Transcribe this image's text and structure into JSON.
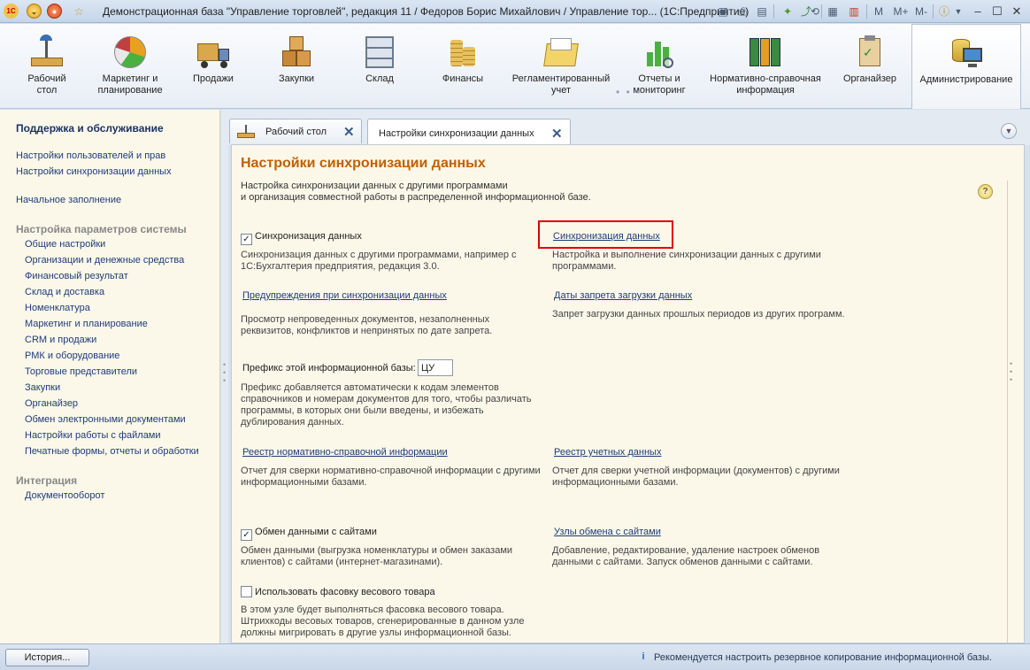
{
  "window": {
    "title": "Демонстрационная база \"Управление торговлей\", редакция 11 / Федоров Борис Михайлович / Управление тор...  (1С:Предприятие)",
    "app_badge": "1С",
    "memory_buttons": [
      "M",
      "M+",
      "M-"
    ]
  },
  "sections": [
    {
      "label": "Рабочий\nстол",
      "icon": "desk-icon"
    },
    {
      "label": "Маркетинг и\nпланирование",
      "icon": "pie-chart-icon"
    },
    {
      "label": "Продажи",
      "icon": "truck-icon"
    },
    {
      "label": "Закупки",
      "icon": "boxes-icon"
    },
    {
      "label": "Склад",
      "icon": "warehouse-icon"
    },
    {
      "label": "Финансы",
      "icon": "coins-icon"
    },
    {
      "label": "Регламентированный\nучет",
      "icon": "folder-icon"
    },
    {
      "label": "Отчеты и\nмониторинг",
      "icon": "bar-chart-icon"
    },
    {
      "label": "Нормативно-справочная\nинформация",
      "icon": "binders-icon"
    },
    {
      "label": "Органайзер",
      "icon": "clipboard-icon"
    },
    {
      "label": "Администрирование",
      "icon": "computer-icon"
    }
  ],
  "leftnav": {
    "group1_title": "Поддержка и обслуживание",
    "group1_items": [
      "Настройки пользователей и прав",
      "Настройки синхронизации данных"
    ],
    "initial_fill": "Начальное заполнение",
    "group2_title": "Настройка параметров системы",
    "group2_items": [
      "Общие настройки",
      "Организации и денежные средства",
      "Финансовый результат",
      "Склад и доставка",
      "Номенклатура",
      "Маркетинг и планирование",
      "CRM и продажи",
      "РМК и оборудование",
      "Торговые представители",
      "Закупки",
      "Органайзер",
      "Обмен электронными документами",
      "Настройки работы с файлами",
      "Печатные формы, отчеты и обработки"
    ],
    "group3_title": "Интеграция",
    "group3_items": [
      "Документооборот"
    ]
  },
  "tabs": [
    {
      "label": "Рабочий стол"
    },
    {
      "label": "Настройки синхронизации данных"
    }
  ],
  "content": {
    "title": "Настройки синхронизации данных",
    "description": "Настройка синхронизации данных с другими программами\nи организация совместной работы в распределенной информационной базе.",
    "help": "?",
    "sync_checkbox_label": "Синхронизация данных",
    "sync_checkbox_checked": true,
    "sync_checkbox_desc": "Синхронизация данных с другими программами, например с\n1С:Бухгалтерия предприятия, редакция 3.0.",
    "sync_link": "Синхронизация данных",
    "sync_link_desc": "Настройка и выполнение синхронизации данных с другими\nпрограммами.",
    "warnings_link": "Предупреждения при синхронизации данных",
    "warnings_desc": "Просмотр непроведенных документов, незаполненных\nреквизитов, конфликтов и непринятых по дате запрета.",
    "prohibit_link": "Даты запрета загрузки данных",
    "prohibit_desc": "Запрет загрузки данных прошлых периодов из других программ.",
    "prefix_label": "Префикс этой информационной базы:",
    "prefix_value": "ЦУ",
    "prefix_desc": "Префикс добавляется автоматически к кодам элементов\nсправочников и номерам документов для того, чтобы различать\nпрограммы, в которых они были введены, и избежать\nдублирования данных.",
    "nsi_link": "Реестр нормативно-справочной информации",
    "nsi_desc": "Отчет для сверки нормативно-справочной информации с другими\nинформационными базами.",
    "accounting_link": "Реестр учетных данных",
    "accounting_desc": "Отчет для сверки учетной информации (документов) с другими\nинформационными базами.",
    "sites_checkbox_label": "Обмен данными с сайтами",
    "sites_checkbox_checked": true,
    "sites_checkbox_desc": "Обмен данными (выгрузка номенклатуры и обмен заказами\nклиентов) с сайтами (интернет-магазинами).",
    "sites_link": "Узлы обмена с сайтами",
    "sites_link_desc": "Добавление, редактирование, удаление настроек обменов\nданными с сайтами. Запуск обменов данными с сайтами.",
    "weight_checkbox_label": "Использовать фасовку весового товара",
    "weight_checkbox_checked": false,
    "weight_checkbox_desc": "В этом узле будет выполняться фасовка весового товара.\nШтрихкоды весовых товаров, сгенерированные в данном узле\nдолжны мигрировать в другие узлы информационной базы."
  },
  "statusbar": {
    "history_button": "История...",
    "message": "Рекомендуется настроить резервное копирование информационной базы."
  },
  "colors": {
    "title_accent": "#c06000",
    "link": "#1e3c78",
    "highlight": "#e00000",
    "panel_bg": "#fbf8ea"
  }
}
